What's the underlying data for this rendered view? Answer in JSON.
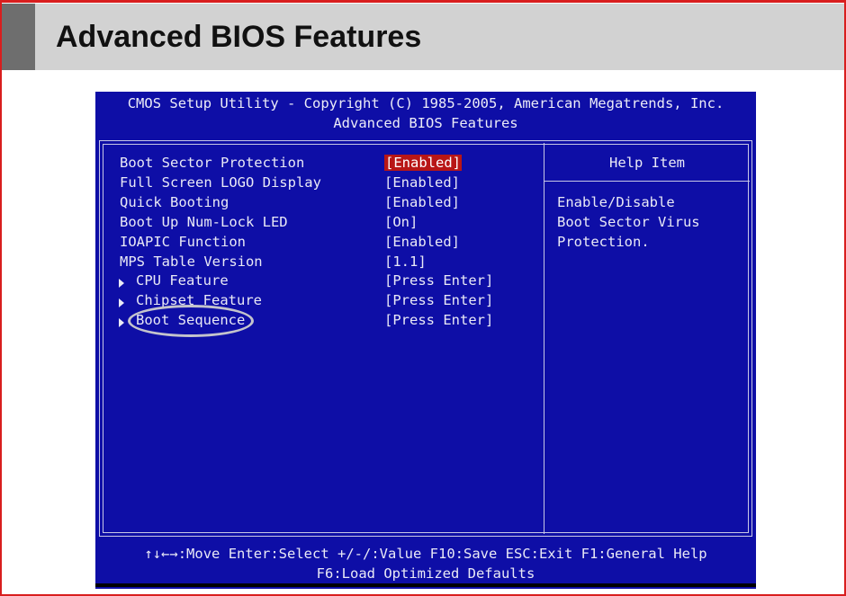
{
  "slide": {
    "title": "Advanced BIOS Features"
  },
  "bios": {
    "header_line1": "CMOS Setup Utility - Copyright (C) 1985-2005, American Megatrends, Inc.",
    "header_line2": "Advanced BIOS Features",
    "items": [
      {
        "label": "Boot Sector Protection",
        "value": "[Enabled]",
        "submenu": false,
        "selected": true
      },
      {
        "label": "Full Screen LOGO Display",
        "value": "[Enabled]",
        "submenu": false,
        "selected": false
      },
      {
        "label": "Quick Booting",
        "value": "[Enabled]",
        "submenu": false,
        "selected": false
      },
      {
        "label": "Boot Up Num-Lock LED",
        "value": "[On]",
        "submenu": false,
        "selected": false
      },
      {
        "label": "IOAPIC Function",
        "value": "[Enabled]",
        "submenu": false,
        "selected": false
      },
      {
        "label": "MPS Table Version",
        "value": "[1.1]",
        "submenu": false,
        "selected": false
      },
      {
        "label": "CPU Feature",
        "value": "[Press Enter]",
        "submenu": true,
        "selected": false
      },
      {
        "label": "Chipset Feature",
        "value": "[Press Enter]",
        "submenu": true,
        "selected": false
      },
      {
        "label": "Boot Sequence",
        "value": "[Press Enter]",
        "submenu": true,
        "selected": false
      }
    ],
    "help": {
      "title": "Help Item",
      "lines": [
        "Enable/Disable",
        "Boot Sector Virus",
        "Protection."
      ]
    },
    "footer_line1": "↑↓←→:Move  Enter:Select  +/-/:Value  F10:Save  ESC:Exit  F1:General Help",
    "footer_line2": "F6:Load Optimized Defaults"
  },
  "colors": {
    "bios_background": "#0e0ea6",
    "selection_highlight": "#b81616",
    "slide_border": "#d81e1e"
  }
}
